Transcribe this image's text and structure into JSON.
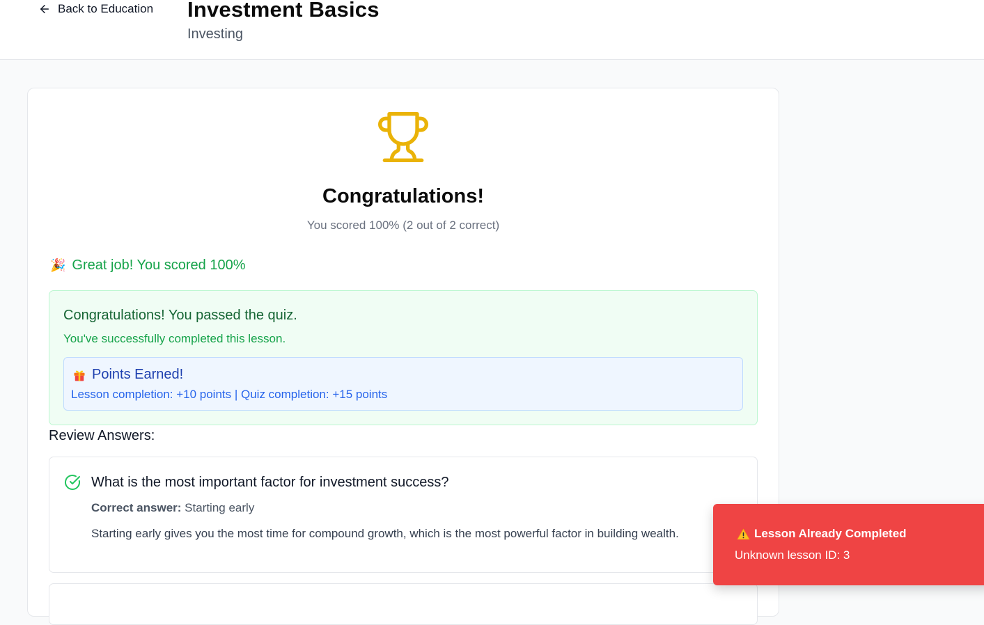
{
  "header": {
    "back_label": "Back to Education",
    "title": "Investment Basics",
    "subtitle": "Investing"
  },
  "result": {
    "heading": "Congratulations!",
    "score_text": "You scored 100% (2 out of 2 correct)",
    "great_job": "Great job! You scored 100%"
  },
  "pass_box": {
    "title": "Congratulations! You passed the quiz.",
    "subtitle": "You've successfully completed this lesson.",
    "points_title": "Points Earned!",
    "points_detail": "Lesson completion: +10 points | Quiz completion: +15 points"
  },
  "review": {
    "label": "Review Answers:",
    "items": [
      {
        "question": "What is the most important factor for investment success?",
        "correct_label": "Correct answer:",
        "correct_value": " Starting early",
        "explanation": "Starting early gives you the most time for compound growth, which is the most powerful factor in building wealth."
      }
    ]
  },
  "toast": {
    "title": "Lesson Already Completed",
    "message": "Unknown lesson ID: 3"
  },
  "colors": {
    "trophy": "#eab308",
    "success": "#16a34a",
    "points": "#2563eb",
    "toast_bg": "#ef4444"
  },
  "icons": [
    "arrow-left-icon",
    "trophy-icon",
    "party-popper-icon",
    "gift-icon",
    "check-circle-icon",
    "warning-icon"
  ]
}
